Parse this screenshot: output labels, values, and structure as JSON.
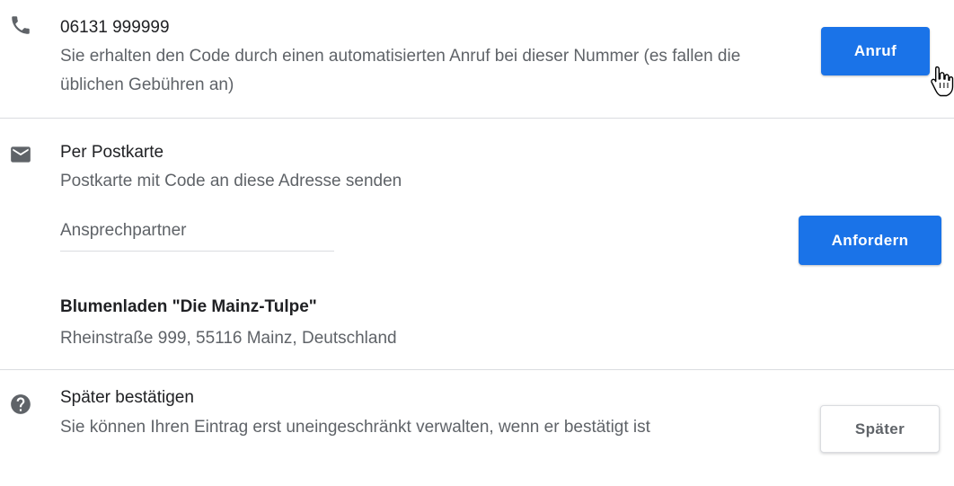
{
  "phone": {
    "number": "06131 999999",
    "description": "Sie erhalten den Code durch einen automatisierten Anruf bei dieser Nummer (es fallen die üblichen Gebühren an)",
    "button_label": "Anruf",
    "icon": "phone-icon"
  },
  "postcard": {
    "title": "Per Postkarte",
    "description": "Postkarte mit Code an diese Adresse senden",
    "contact_placeholder": "Ansprechpartner",
    "contact_value": "",
    "button_label": "Anfordern",
    "business_name": "Blumenladen \"Die Mainz-Tulpe\"",
    "business_address": "Rheinstraße 999, 55116 Mainz, Deutschland",
    "icon": "mail-icon"
  },
  "later": {
    "title": "Später bestätigen",
    "description": "Sie können Ihren Eintrag erst uneingeschränkt verwalten, wenn er bestätigt ist",
    "button_label": "Später",
    "icon": "help-icon"
  },
  "colors": {
    "primary_button": "#1a73e8",
    "text_primary": "#202124",
    "text_secondary": "#5f6368",
    "divider": "#dadce0",
    "icon": "#5f6368"
  }
}
